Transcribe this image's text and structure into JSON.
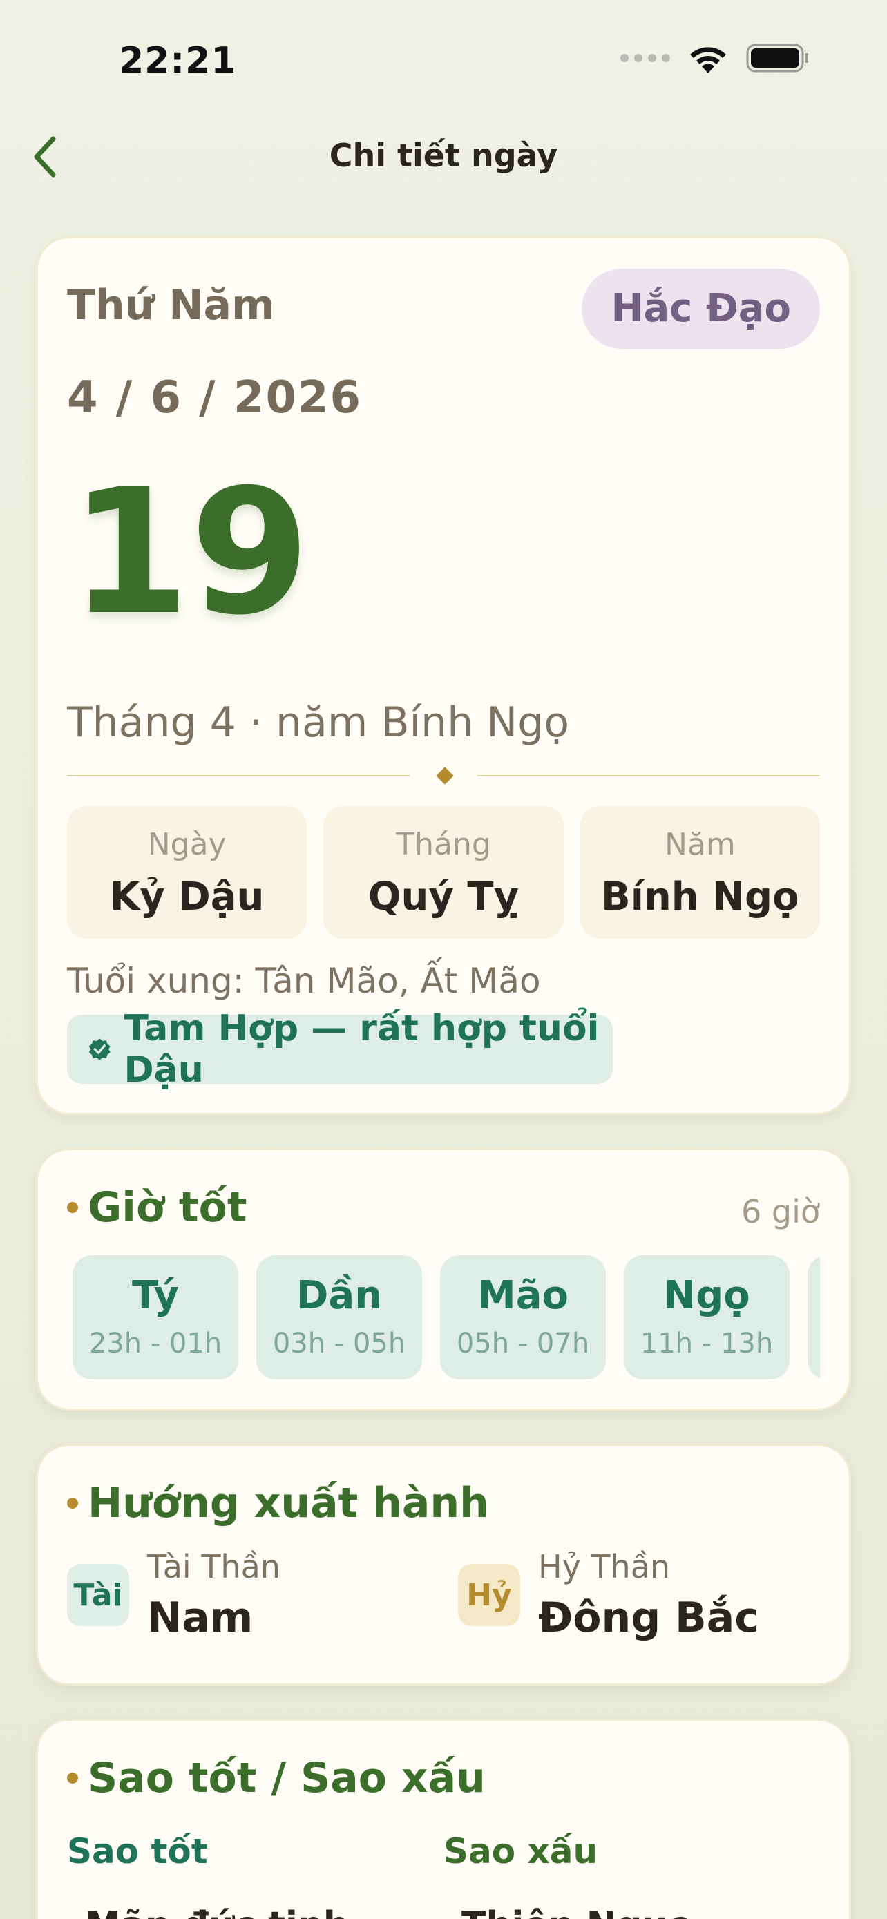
{
  "status": {
    "time": "22:21"
  },
  "nav": {
    "title": "Chi tiết ngày"
  },
  "day_card": {
    "weekday": "Thứ Năm",
    "badge": "Hắc Đạo",
    "solar_date": "4 / 6 / 2026",
    "lunar_day": "19",
    "lunar_line": "Tháng 4 · năm Bính Ngọ",
    "can_chi": [
      {
        "label": "Ngày",
        "value": "Kỷ Dậu"
      },
      {
        "label": "Tháng",
        "value": "Quý Tỵ"
      },
      {
        "label": "Năm",
        "value": "Bính Ngọ"
      }
    ],
    "tuoi_xung": "Tuổi xung: Tân Mão, Ất Mão",
    "tam_hop": "Tam Hợp — rất hợp tuổi Dậu"
  },
  "good_hours": {
    "title": "Giờ tốt",
    "count": "6 giờ",
    "items": [
      {
        "name": "Tý",
        "range": "23h - 01h"
      },
      {
        "name": "Dần",
        "range": "03h - 05h"
      },
      {
        "name": "Mão",
        "range": "05h - 07h"
      },
      {
        "name": "Ngọ",
        "range": "11h - 13h"
      }
    ]
  },
  "direction": {
    "title": "Hướng xuất hành",
    "tai": {
      "badge": "Tài",
      "label": "Tài Thần",
      "value": "Nam"
    },
    "hy": {
      "badge": "Hỷ",
      "label": "Hỷ Thần",
      "value": "Đông Bắc"
    }
  },
  "stars": {
    "title": "Sao tốt / Sao xấu",
    "good_title": "Sao tốt",
    "bad_title": "Sao xấu",
    "good_first": "Mãn đức tinh",
    "bad_first": "Thiên Ngục"
  },
  "colors": {
    "accent_green": "#3b6e2a",
    "teal": "#1f7358",
    "gold": "#b48c2e",
    "badge_purple": "#735f82",
    "card_bg": "#fffdf6"
  }
}
